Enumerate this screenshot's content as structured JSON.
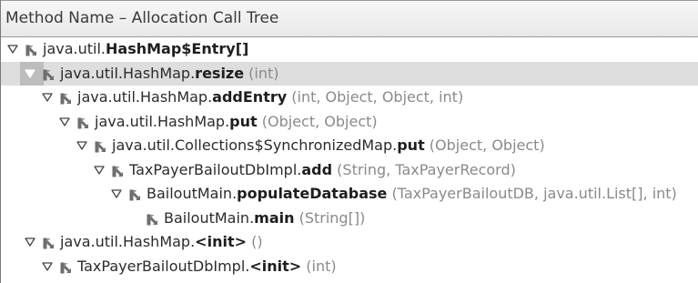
{
  "header": {
    "title": "Method Name – Allocation Call Tree"
  },
  "icons": {
    "expanded": "triangle-down-icon",
    "node": "allocation-node-icon"
  },
  "colors": {
    "selected_row": "#dedede",
    "args_text": "#8a8a8a"
  },
  "rows": [
    {
      "depth": 0,
      "expanded": true,
      "selected": false,
      "prefix": "java.util.",
      "method": "HashMap$Entry[]",
      "args": ""
    },
    {
      "depth": 1,
      "expanded": true,
      "selected": true,
      "prefix": "java.util.HashMap.",
      "method": "resize",
      "args": " (int)"
    },
    {
      "depth": 2,
      "expanded": true,
      "selected": false,
      "prefix": "java.util.HashMap.",
      "method": "addEntry",
      "args": " (int, Object, Object, int)"
    },
    {
      "depth": 3,
      "expanded": true,
      "selected": false,
      "prefix": "java.util.HashMap.",
      "method": "put",
      "args": " (Object, Object)"
    },
    {
      "depth": 4,
      "expanded": true,
      "selected": false,
      "prefix": "java.util.Collections$SynchronizedMap.",
      "method": "put",
      "args": " (Object, Object)"
    },
    {
      "depth": 5,
      "expanded": true,
      "selected": false,
      "prefix": "TaxPayerBailoutDbImpl.",
      "method": "add",
      "args": " (String, TaxPayerRecord)"
    },
    {
      "depth": 6,
      "expanded": true,
      "selected": false,
      "prefix": "BailoutMain.",
      "method": "populateDatabase",
      "args": " (TaxPayerBailoutDB, java.util.List[], int)"
    },
    {
      "depth": 7,
      "expanded": false,
      "selected": false,
      "prefix": "BailoutMain.",
      "method": "main",
      "args": " (String[])"
    },
    {
      "depth": 1,
      "expanded": true,
      "selected": false,
      "prefix": "java.util.HashMap.",
      "method": "<init>",
      "args": " ()"
    },
    {
      "depth": 2,
      "expanded": true,
      "selected": false,
      "prefix": "TaxPayerBailoutDbImpl.",
      "method": "<init>",
      "args": " (int)"
    }
  ]
}
